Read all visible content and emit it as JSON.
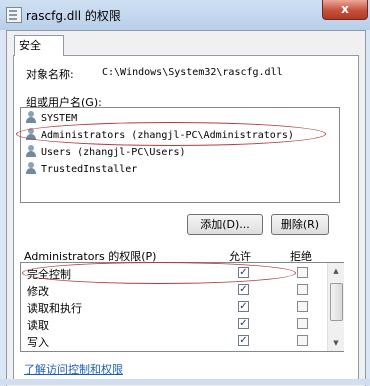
{
  "window": {
    "title": "rascfg.dll 的权限",
    "close_label": "x"
  },
  "tabs": [
    {
      "label": "安全"
    }
  ],
  "security": {
    "object_name_label": "对象名称:",
    "object_name_value": "C:\\Windows\\System32\\rascfg.dll",
    "group_user_label": "组或用户名(G):",
    "users": [
      {
        "name": "SYSTEM"
      },
      {
        "name": "Administrators (zhangjl-PC\\Administrators)"
      },
      {
        "name": "Users (zhangjl-PC\\Users)"
      },
      {
        "name": "TrustedInstaller"
      }
    ],
    "add_button": "添加(D)...",
    "remove_button": "删除(R)",
    "permissions_label": "Administrators 的权限(P)",
    "col_allow": "允许",
    "col_deny": "拒绝",
    "permissions": [
      {
        "name": "完全控制",
        "allow": true,
        "deny": false
      },
      {
        "name": "修改",
        "allow": true,
        "deny": false
      },
      {
        "name": "读取和执行",
        "allow": true,
        "deny": false
      },
      {
        "name": "读取",
        "allow": true,
        "deny": false
      },
      {
        "name": "写入",
        "allow": true,
        "deny": false
      }
    ],
    "link": "了解访问控制和权限"
  },
  "icons": {
    "user": "user-group-icon",
    "check": "checkmark-icon"
  }
}
